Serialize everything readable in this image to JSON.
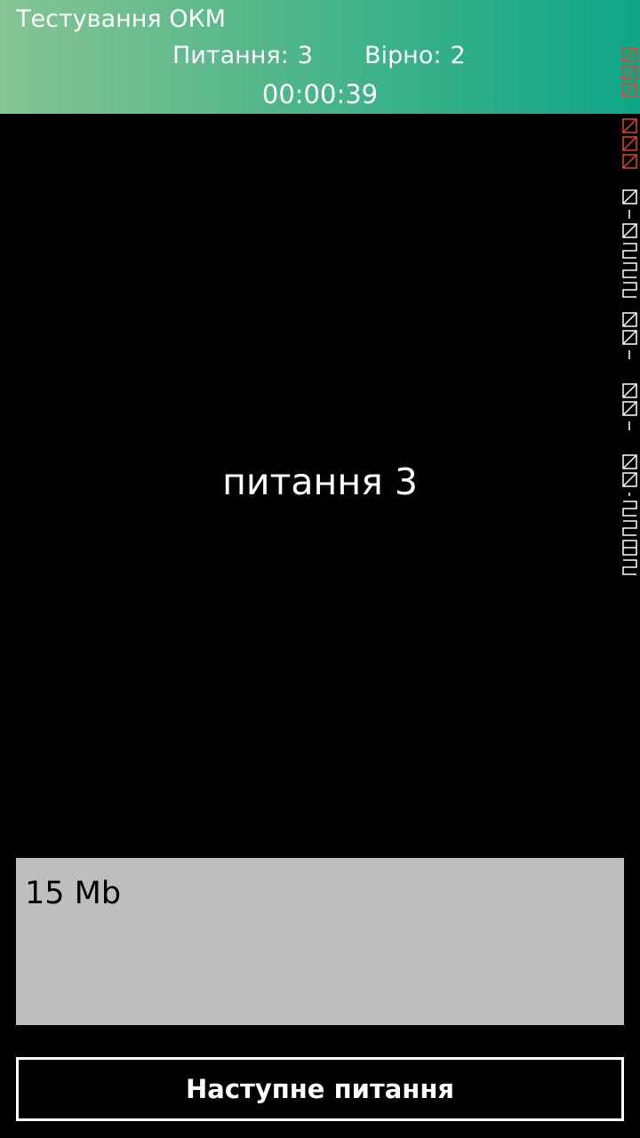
{
  "header": {
    "title": "Тестування ОКМ",
    "questions_label": "Питання:",
    "questions_value": "3",
    "correct_label": "Вірно:",
    "correct_value": "2",
    "timer": "00:00:39"
  },
  "question": {
    "text": "питання 3"
  },
  "answer": {
    "text": "15 Mb"
  },
  "actions": {
    "next_label": "Наступне питання"
  },
  "colors": {
    "header_gradient_start": "#86c493",
    "header_gradient_end": "#0ea686",
    "answer_background": "#bebebe",
    "debug_red": "#e0462e"
  }
}
